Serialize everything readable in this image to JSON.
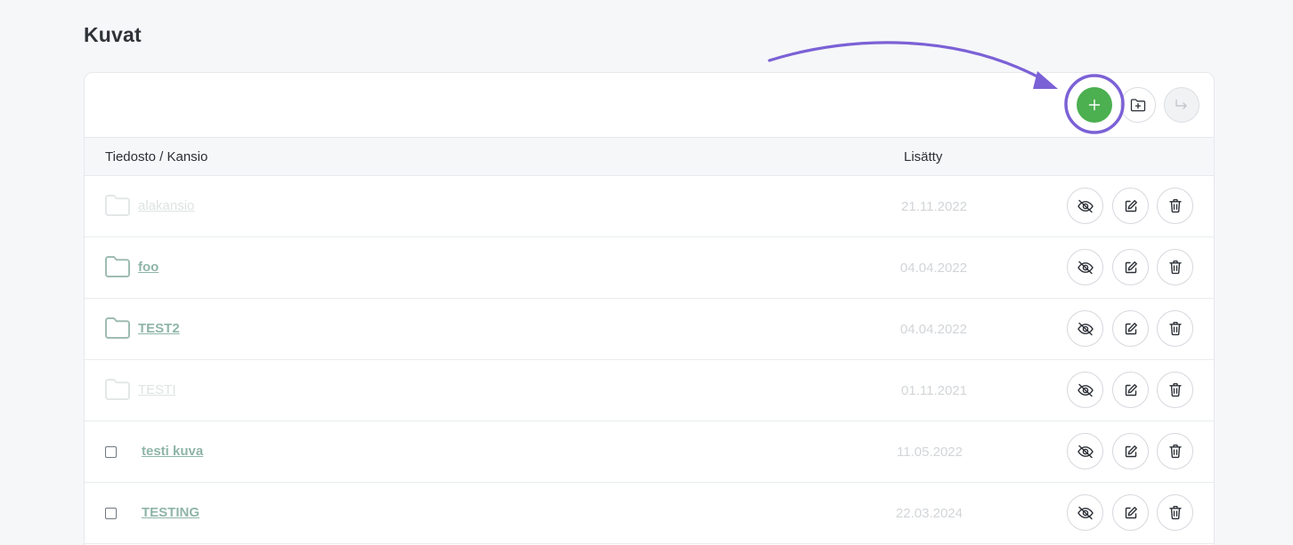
{
  "page": {
    "title": "Kuvat"
  },
  "toolbar": {
    "add_button": "plus-icon",
    "new_folder_button": "folder-plus-icon",
    "move_button": "move-arrow-icon",
    "accent_color": "#4caf50"
  },
  "table": {
    "headers": {
      "name": "Tiedosto / Kansio",
      "added": "Lisätty"
    },
    "rows": [
      {
        "type": "folder",
        "name": "alakansio",
        "date": "21.11.2022",
        "state": "muted"
      },
      {
        "type": "folder",
        "name": "foo",
        "date": "04.04.2022",
        "state": "active"
      },
      {
        "type": "folder",
        "name": "TEST2",
        "date": "04.04.2022",
        "state": "active"
      },
      {
        "type": "folder",
        "name": "TESTI",
        "date": "01.11.2021",
        "state": "muted"
      },
      {
        "type": "file",
        "name": "testi kuva",
        "date": "11.05.2022",
        "state": "active"
      },
      {
        "type": "file",
        "name": "TESTING",
        "date": "22.03.2024",
        "state": "active"
      }
    ],
    "row_actions": [
      "eye-off-icon",
      "edit-icon",
      "trash-icon"
    ]
  },
  "annotation": {
    "color": "#7b61d6"
  }
}
